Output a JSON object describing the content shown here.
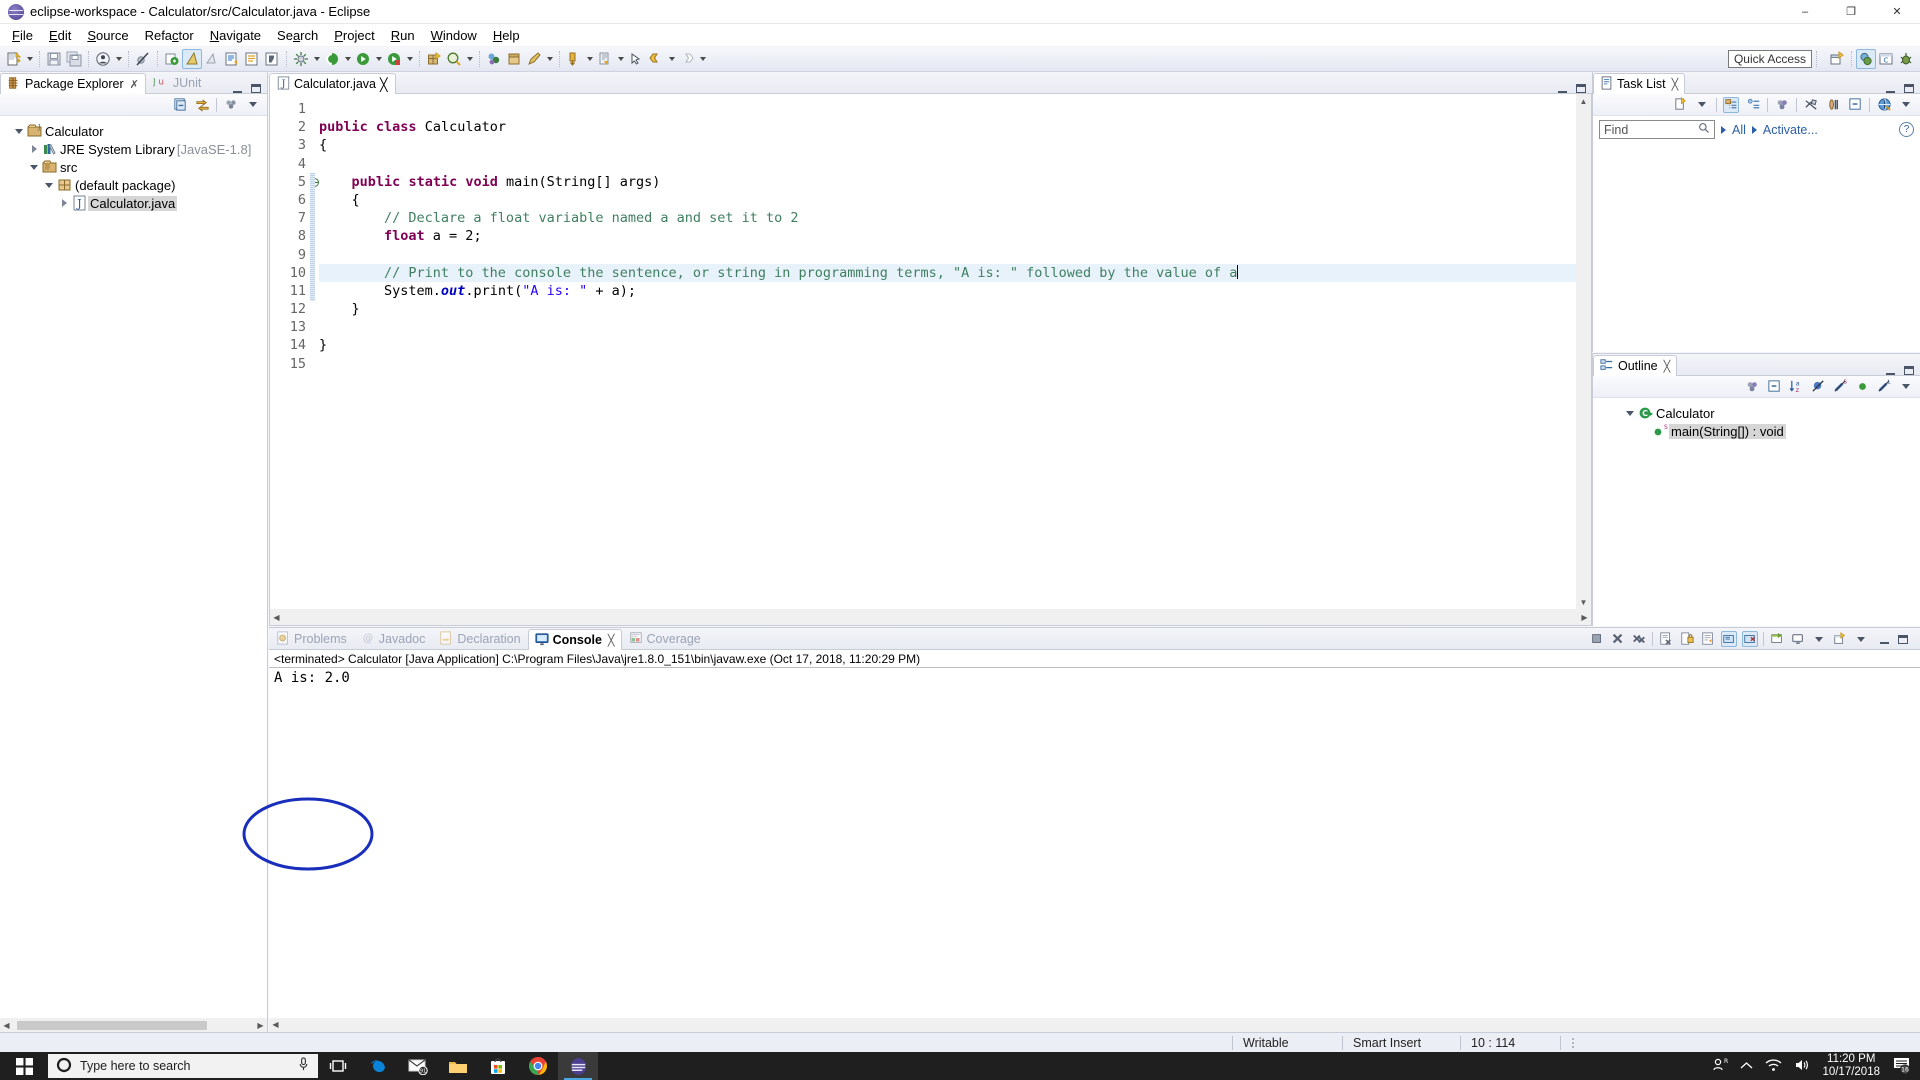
{
  "window": {
    "title": "eclipse-workspace - Calculator/src/Calculator.java - Eclipse",
    "minimize": "–",
    "maximize": "❐",
    "close": "✕"
  },
  "menubar": {
    "items": [
      {
        "label": "File",
        "mnemonic": "F"
      },
      {
        "label": "Edit",
        "mnemonic": "E"
      },
      {
        "label": "Source",
        "mnemonic": "S"
      },
      {
        "label": "Refactor",
        "mnemonic": "c"
      },
      {
        "label": "Navigate",
        "mnemonic": "N"
      },
      {
        "label": "Search",
        "mnemonic": "a"
      },
      {
        "label": "Project",
        "mnemonic": "P"
      },
      {
        "label": "Run",
        "mnemonic": "R"
      },
      {
        "label": "Window",
        "mnemonic": "W"
      },
      {
        "label": "Help",
        "mnemonic": "H"
      }
    ]
  },
  "toolbar": {
    "quick_access_placeholder": "Quick Access",
    "icons": [
      "new-wizard-icon",
      "save-icon",
      "save-all-icon",
      "print-icon",
      "skip-breakpoints-icon",
      "new-java-project-icon",
      "new-java-class-icon",
      "external-tools-icon",
      "open-task-icon",
      "open-type-icon",
      "toggle-mark-occurrences-icon",
      "debug-icon",
      "run-icon",
      "run-as-icon",
      "coverage-icon",
      "new-package-icon",
      "search-icon",
      "open-perspective-icon",
      "previous-annotation-icon",
      "next-annotation-icon",
      "last-edit-location-icon",
      "back-icon",
      "forward-icon"
    ],
    "perspective_icons": [
      "open-perspective-icon",
      "java-perspective-icon",
      "java-ee-perspective-icon",
      "debug-perspective-icon"
    ]
  },
  "package_explorer": {
    "tabs": [
      {
        "label": "Package Explorer",
        "active": true,
        "icon": "package-explorer-icon"
      },
      {
        "label": "JUnit",
        "active": false,
        "icon": "junit-icon"
      }
    ],
    "view_toolbar": [
      "collapse-all-icon",
      "link-with-editor-icon",
      "view-menu-dots-icon",
      "view-menu-caret-icon"
    ],
    "tree": [
      {
        "label": "Calculator",
        "depth": 0,
        "twisty": "down",
        "icon": "java-project-icon",
        "suffix": "",
        "selected": false
      },
      {
        "label": "JRE System Library",
        "depth": 1,
        "twisty": "right",
        "icon": "library-icon",
        "suffix": " [JavaSE-1.8]",
        "selected": false
      },
      {
        "label": "src",
        "depth": 1,
        "twisty": "down",
        "icon": "source-folder-icon",
        "suffix": "",
        "selected": false
      },
      {
        "label": "(default package)",
        "depth": 2,
        "twisty": "down",
        "icon": "package-icon",
        "suffix": "",
        "selected": false
      },
      {
        "label": "Calculator.java",
        "depth": 3,
        "twisty": "right",
        "icon": "java-file-icon",
        "suffix": "",
        "selected": true
      }
    ]
  },
  "editor": {
    "tab": {
      "label": "Calculator.java",
      "icon": "java-file-icon",
      "close": "╳"
    },
    "line_numbers": [
      "1",
      "2",
      "3",
      "4",
      "5",
      "6",
      "7",
      "8",
      "9",
      "10",
      "11",
      "12",
      "13",
      "14",
      "15"
    ],
    "fold_line": 5,
    "highlight_line": 10,
    "lines": [
      {
        "n": 1,
        "tokens": []
      },
      {
        "n": 2,
        "tokens": [
          {
            "t": "public",
            "c": "kw"
          },
          {
            "t": " ",
            "c": ""
          },
          {
            "t": "class",
            "c": "kw"
          },
          {
            "t": " Calculator",
            "c": ""
          }
        ]
      },
      {
        "n": 3,
        "tokens": [
          {
            "t": "{",
            "c": ""
          }
        ]
      },
      {
        "n": 4,
        "tokens": []
      },
      {
        "n": 5,
        "tokens": [
          {
            "t": "    ",
            "c": ""
          },
          {
            "t": "public",
            "c": "kw"
          },
          {
            "t": " ",
            "c": ""
          },
          {
            "t": "static",
            "c": "kw"
          },
          {
            "t": " ",
            "c": ""
          },
          {
            "t": "void",
            "c": "kw"
          },
          {
            "t": " main(String[] args)",
            "c": ""
          }
        ]
      },
      {
        "n": 6,
        "tokens": [
          {
            "t": "    {",
            "c": ""
          }
        ]
      },
      {
        "n": 7,
        "tokens": [
          {
            "t": "        // Declare a float variable named a and set it to 2",
            "c": "cm"
          }
        ]
      },
      {
        "n": 8,
        "tokens": [
          {
            "t": "        ",
            "c": ""
          },
          {
            "t": "float",
            "c": "kw"
          },
          {
            "t": " a = 2;",
            "c": ""
          }
        ]
      },
      {
        "n": 9,
        "tokens": []
      },
      {
        "n": 10,
        "tokens": [
          {
            "t": "        // Print to the console the sentence, or string in programming terms, \"A is: \" followed by the value of a",
            "c": "cm"
          }
        ]
      },
      {
        "n": 11,
        "tokens": [
          {
            "t": "        System.",
            "c": ""
          },
          {
            "t": "out",
            "c": "fld"
          },
          {
            "t": ".print(",
            "c": ""
          },
          {
            "t": "\"A is: \"",
            "c": "st"
          },
          {
            "t": " + a);",
            "c": ""
          }
        ]
      },
      {
        "n": 12,
        "tokens": [
          {
            "t": "    }",
            "c": ""
          }
        ]
      },
      {
        "n": 13,
        "tokens": []
      },
      {
        "n": 14,
        "tokens": [
          {
            "t": "}",
            "c": ""
          }
        ]
      },
      {
        "n": 15,
        "tokens": []
      }
    ]
  },
  "task_list": {
    "tab": {
      "label": "Task List",
      "icon": "task-list-icon",
      "close": "╳"
    },
    "toolbar": [
      "new-task-icon",
      "new-task-caret",
      "categorized-mode-icon",
      "scheduled-mode-icon",
      "focus-icon",
      "filter-icon",
      "synchronize-icon",
      "collapse-all-icon",
      "restore-icon",
      "view-menu-caret-icon"
    ],
    "find_placeholder": "Find",
    "find_value": "",
    "all_label": "All",
    "activate_label": "Activate...",
    "help_label": "?"
  },
  "outline": {
    "tab": {
      "label": "Outline",
      "icon": "outline-icon",
      "close": "╳"
    },
    "toolbar": [
      "focus-icon",
      "collapse-all-icon",
      "sort-icon",
      "hide-fields-icon",
      "hide-static-icon",
      "hide-nonpublic-icon",
      "hide-local-icon",
      "view-menu-caret-icon"
    ],
    "items": [
      {
        "label": "Calculator",
        "depth": 0,
        "twisty": "down",
        "icon": "class-icon",
        "selected": false
      },
      {
        "label": "main(String[]) : void",
        "depth": 1,
        "twisty": "none",
        "icon": "public-method-static-icon",
        "selected": true
      }
    ]
  },
  "console": {
    "tabs": [
      {
        "label": "Problems",
        "active": false,
        "icon": "problems-icon"
      },
      {
        "label": "Javadoc",
        "active": false,
        "icon": "javadoc-icon"
      },
      {
        "label": "Declaration",
        "active": false,
        "icon": "declaration-icon"
      },
      {
        "label": "Console",
        "active": true,
        "icon": "console-icon",
        "close": "╳"
      },
      {
        "label": "Coverage",
        "active": false,
        "icon": "coverage-icon"
      }
    ],
    "toolbar": [
      "terminate-icon",
      "remove-launch-icon",
      "remove-all-launches-icon",
      "clear-console-icon",
      "scroll-lock-icon",
      "word-wrap-icon",
      "show-console-on-output-icon",
      "pin-console-icon",
      "display-selected-console-icon",
      "display-selected-caret",
      "open-console-icon",
      "open-console-caret",
      "minimize-icon",
      "maximize-icon"
    ],
    "header": "<terminated> Calculator [Java Application] C:\\Program Files\\Java\\jre1.8.0_151\\bin\\javaw.exe (Oct 17, 2018, 11:20:29 PM)",
    "output": "A is: 2.0"
  },
  "statusbar": {
    "writable": "Writable",
    "insert_mode": "Smart Insert",
    "position": "10 : 114"
  },
  "taskbar": {
    "search_placeholder": "Type here to search",
    "apps": [
      {
        "name": "task-view-icon",
        "running": false
      },
      {
        "name": "edge-icon",
        "running": false
      },
      {
        "name": "mail-icon",
        "running": false,
        "badge": "91"
      },
      {
        "name": "file-explorer-icon",
        "running": false
      },
      {
        "name": "microsoft-store-icon",
        "running": false
      },
      {
        "name": "chrome-icon",
        "running": false
      },
      {
        "name": "eclipse-icon",
        "running": true
      }
    ],
    "tray": {
      "time": "11:20 PM",
      "date": "10/17/2018",
      "notification_count": "16"
    }
  },
  "colors": {
    "accent": "#2b5fa8",
    "keyword": "#7f0055",
    "comment": "#3f7f5f",
    "string": "#2a00ff",
    "field": "#0000c0",
    "annotation": "#1a2ebc",
    "highlight": "#e8f2fb"
  }
}
